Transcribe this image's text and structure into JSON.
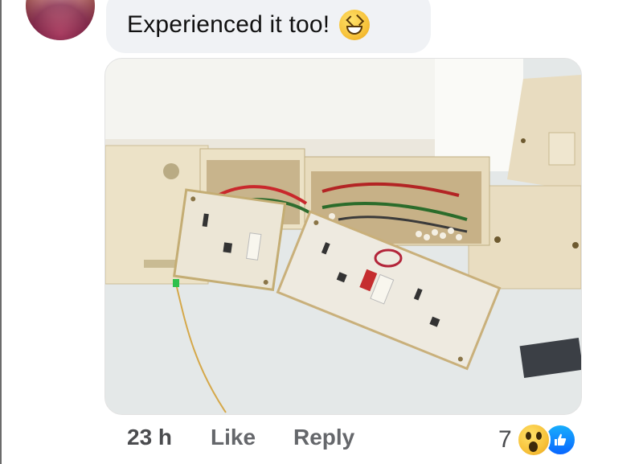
{
  "comment": {
    "text": "Experienced it too!",
    "emoji": "laughing-face-emoji"
  },
  "photo": {
    "description_icon": "photo-attachment"
  },
  "footer": {
    "timestamp": "23 h",
    "like_label": "Like",
    "reply_label": "Reply",
    "reaction_count": "7",
    "reaction_icons": [
      "wow-reaction-icon",
      "like-reaction-icon"
    ]
  },
  "colors": {
    "bubble_bg": "#f0f2f5",
    "action_text": "#65676b",
    "like_blue": "#0866ff"
  }
}
